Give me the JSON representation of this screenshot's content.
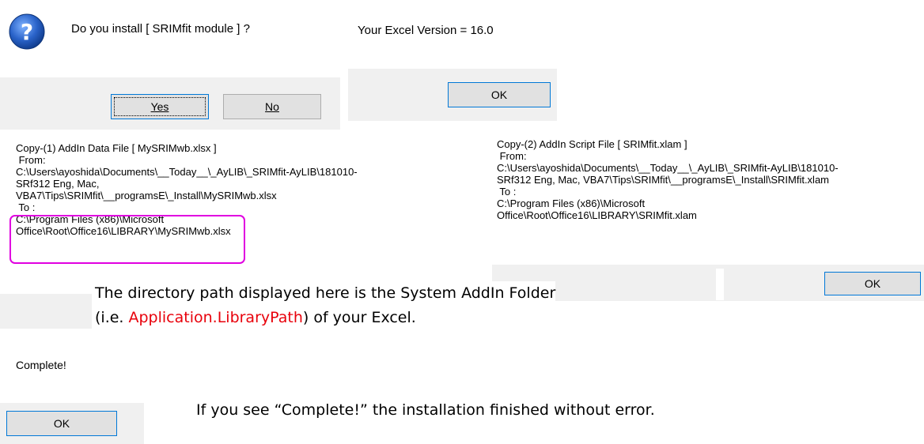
{
  "dialog1": {
    "question": "Do you install [ SRIMfit module ] ?",
    "yes_label": "Yes",
    "no_label": "No"
  },
  "dialog2": {
    "message": "Your Excel Version = 16.0",
    "ok_label": "OK"
  },
  "copy1": {
    "lines": [
      "Copy-(1) AddIn Data File [ MySRIMwb.xlsx ]",
      " From:",
      "C:\\Users\\ayoshida\\Documents\\__Today__\\_AyLIB\\_SRIMfit-AyLIB\\181010-",
      "SRf312 Eng, Mac,",
      "VBA7\\Tips\\SRIMfit\\__programsE\\_Install\\MySRIMwb.xlsx",
      " To :",
      "C:\\Program Files (x86)\\Microsoft",
      "Office\\Root\\Office16\\LIBRARY\\MySRIMwb.xlsx"
    ]
  },
  "copy2": {
    "lines": [
      "Copy-(2) AddIn Script File [ SRIMfit.xlam ]",
      " From:",
      "C:\\Users\\ayoshida\\Documents\\__Today__\\_AyLIB\\_SRIMfit-AyLIB\\181010-",
      "SRf312 Eng, Mac, VBA7\\Tips\\SRIMfit\\__programsE\\_Install\\SRIMfit.xlam",
      " To :",
      "C:\\Program Files (x86)\\Microsoft",
      "Office\\Root\\Office16\\LIBRARY\\SRIMfit.xlam"
    ],
    "ok_label": "OK"
  },
  "note1": {
    "line1": "The directory path displayed here is the System AddIn Folder",
    "line2_prefix": "(i.e. ",
    "line2_highlight": "Application.LibraryPath",
    "line2_suffix": ") of your Excel."
  },
  "complete": {
    "message": "Complete!",
    "ok_label": "OK"
  },
  "note2": {
    "text": "If you see “Complete!” the installation finished without error."
  },
  "icons": {
    "question": "question-icon"
  },
  "colors": {
    "highlight_box": "#e000e0",
    "red_text": "#e8000b",
    "icon_blue": "#1f5fbf"
  }
}
